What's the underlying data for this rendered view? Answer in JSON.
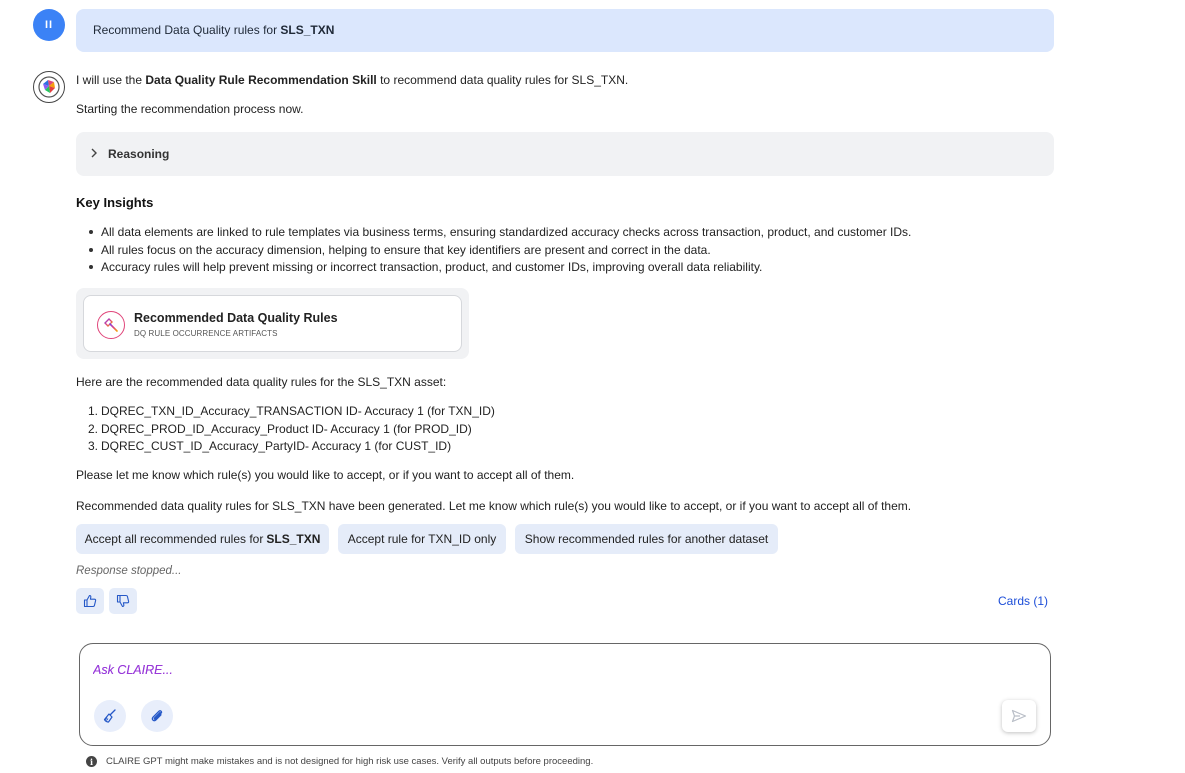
{
  "user_message": {
    "avatar_glyph": "II",
    "prefix": "Recommend Data Quality rules for ",
    "bold": "SLS_TXN"
  },
  "response": {
    "intro_prefix": "I will use the ",
    "intro_bold": "Data Quality Rule Recommendation Skill",
    "intro_suffix": " to recommend data quality rules for SLS_TXN.",
    "starting": "Starting the recommendation process now.",
    "reasoning_label": "Reasoning",
    "insights_heading": "Key Insights",
    "insights": [
      "All data elements are linked to rule templates via business terms, ensuring standardized accuracy checks across transaction, product, and customer IDs.",
      "All rules focus on the accuracy dimension, helping to ensure that key identifiers are present and correct in the data.",
      "Accuracy rules will help prevent missing or incorrect transaction, product, and customer IDs, improving overall data reliability."
    ],
    "card": {
      "title": "Recommended Data Quality Rules",
      "subtitle": "DQ RULE OCCURRENCE ARTIFACTS",
      "icon": "dq-rule-icon"
    },
    "rules_intro": "Here are the recommended data quality rules for the SLS_TXN asset:",
    "rules": [
      {
        "num": "1.",
        "text": "DQREC_TXN_ID_Accuracy_TRANSACTION ID- Accuracy 1 (for TXN_ID)"
      },
      {
        "num": "2.",
        "text": "DQREC_PROD_ID_Accuracy_Product ID- Accuracy 1 (for PROD_ID)"
      },
      {
        "num": "3.",
        "text": "DQREC_CUST_ID_Accuracy_PartyID- Accuracy 1 (for CUST_ID)"
      }
    ],
    "accept_prompt": "Please let me know which rule(s) you would like to accept, or if you want to accept all of them.",
    "generated_note": "Recommended data quality rules for SLS_TXN have been generated. Let me know which rule(s) you would like to accept, or if you want to accept all of them.",
    "suggestions": {
      "accept_all_prefix": "Accept all recommended rules for",
      "accept_all_bold": "SLS_TXN",
      "accept_one": "Accept rule for TXN_ID only",
      "show_other": "Show recommended rules for another dataset"
    },
    "stopped": "Response stopped...",
    "cards_link": "Cards (1)"
  },
  "composer": {
    "placeholder": "Ask CLAIRE..."
  },
  "disclaimer": "CLAIRE GPT might make mistakes and is not designed for high risk use cases. Verify all outputs before proceeding.",
  "colors": {
    "user_bubble": "#dbe7fd",
    "accent": "#3b82f6",
    "chip": "#e5ecf9",
    "link": "#1d4ed8"
  }
}
